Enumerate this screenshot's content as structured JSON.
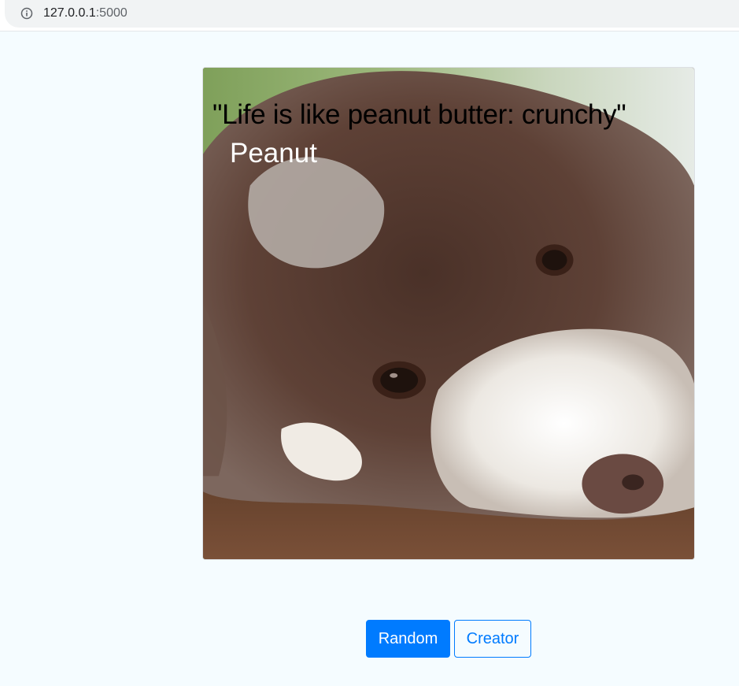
{
  "browser": {
    "url_host": "127.0.0.1",
    "url_port": ":5000"
  },
  "meme": {
    "quote": "\"Life is like peanut butter: crunchy\"",
    "author": "Peanut",
    "photo_subject": "brown and white dog resting head on wooden floor"
  },
  "actions": {
    "random_label": "Random",
    "creator_label": "Creator"
  },
  "colors": {
    "page_background": "#f5fcff",
    "primary": "#007bff"
  }
}
